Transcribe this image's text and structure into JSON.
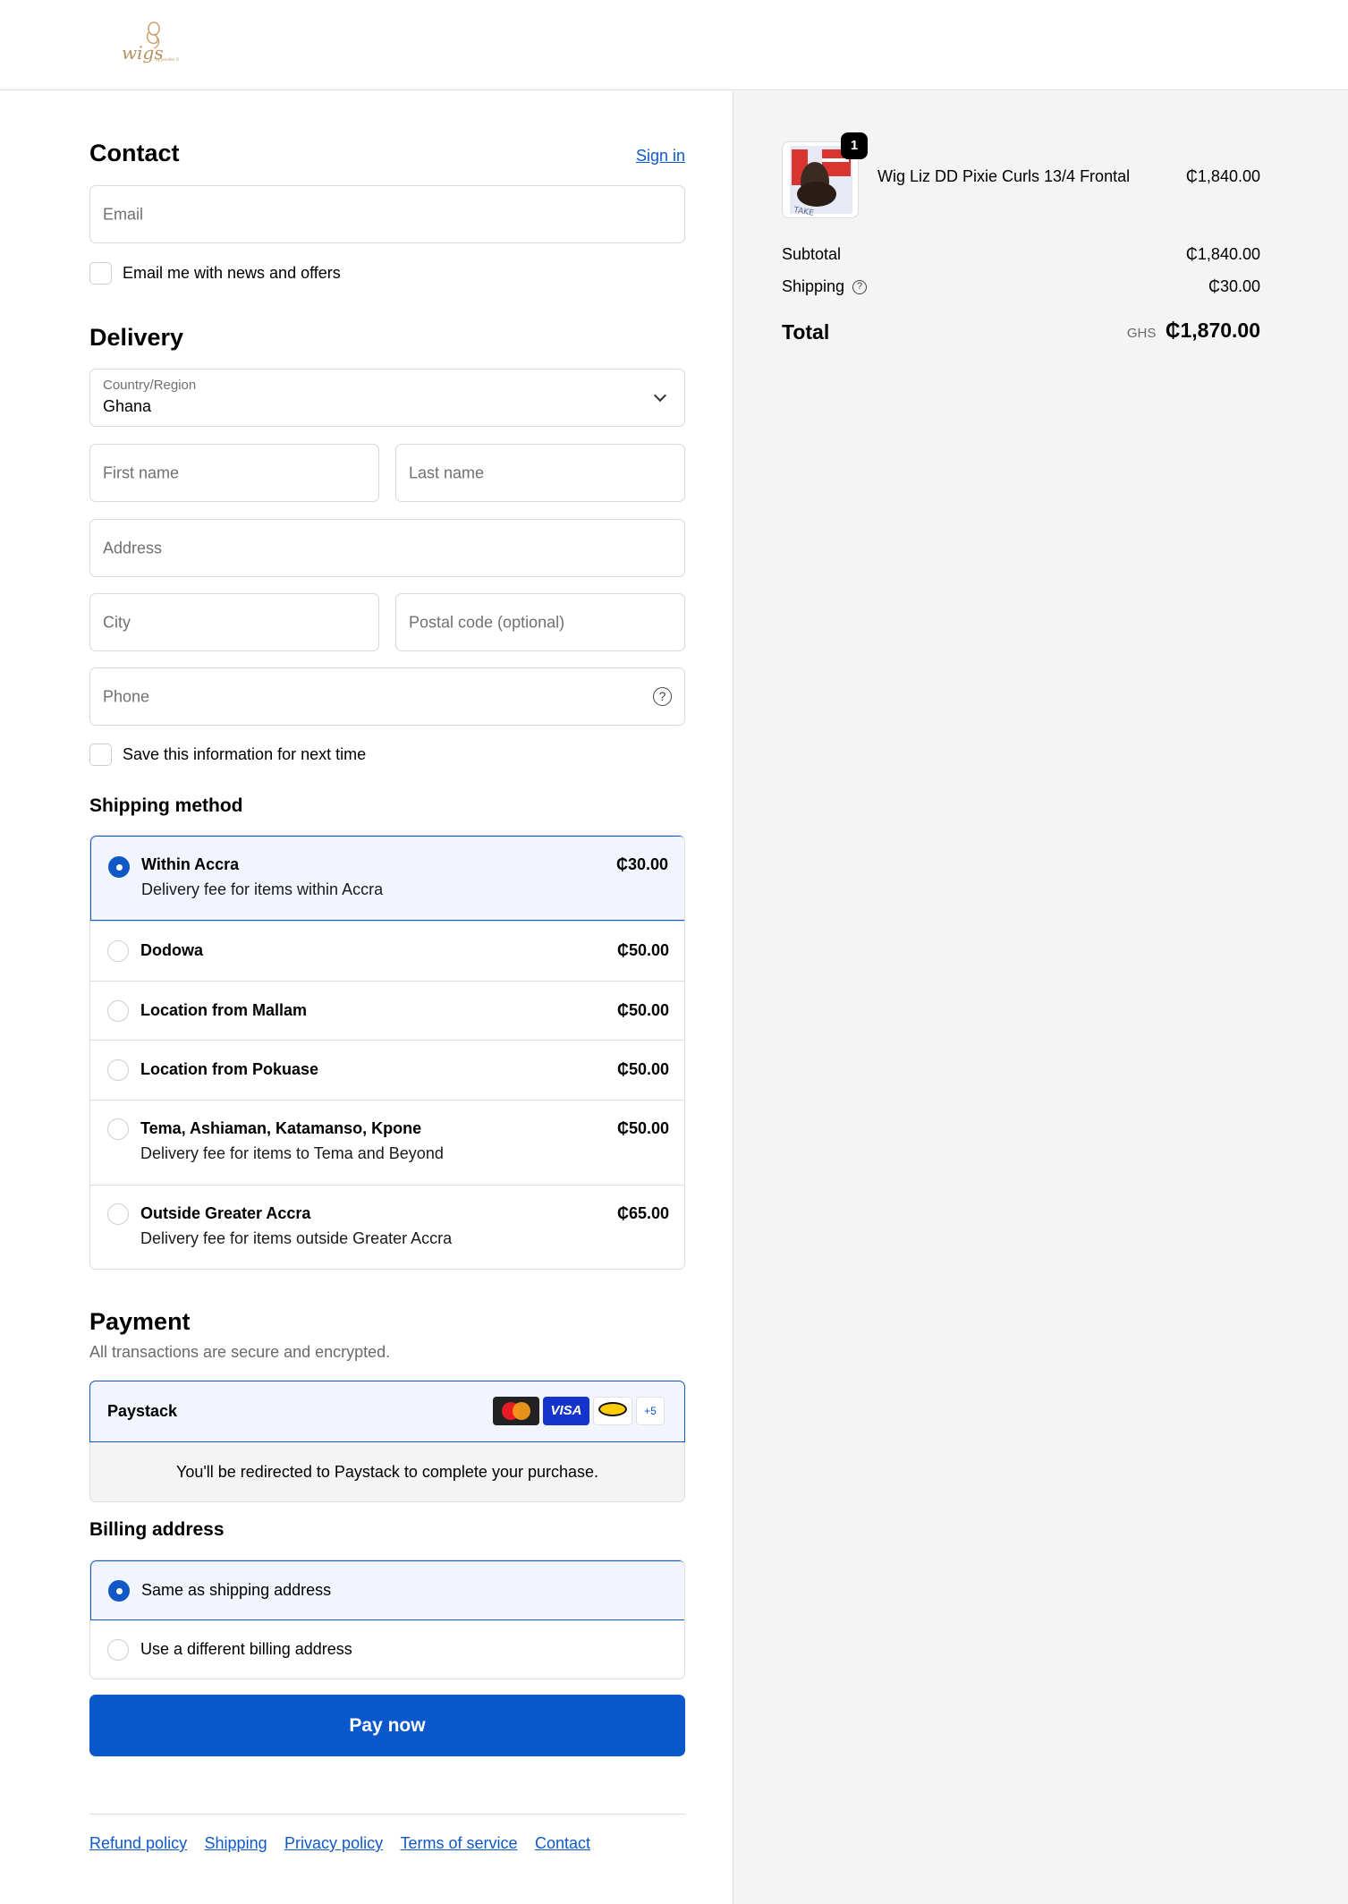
{
  "header": {
    "logo_text": "wigs"
  },
  "contact": {
    "title": "Contact",
    "sign_in": "Sign in",
    "email_placeholder": "Email",
    "news_label": "Email me with news and offers"
  },
  "delivery": {
    "title": "Delivery",
    "country_label": "Country/Region",
    "country_value": "Ghana",
    "first_name_placeholder": "First name",
    "last_name_placeholder": "Last name",
    "address_placeholder": "Address",
    "city_placeholder": "City",
    "postal_placeholder": "Postal code (optional)",
    "phone_placeholder": "Phone",
    "save_label": "Save this information for next time"
  },
  "shipping_method": {
    "title": "Shipping method",
    "options": [
      {
        "name": "Within Accra",
        "desc": "Delivery fee for items within Accra",
        "price": "₵30.00",
        "selected": true
      },
      {
        "name": "Dodowa",
        "desc": "",
        "price": "₵50.00",
        "selected": false
      },
      {
        "name": "Location from Mallam",
        "desc": "",
        "price": "₵50.00",
        "selected": false
      },
      {
        "name": "Location from Pokuase",
        "desc": "",
        "price": "₵50.00",
        "selected": false
      },
      {
        "name": "Tema, Ashiaman, Katamanso, Kpone",
        "desc": "Delivery fee for items to Tema and Beyond",
        "price": "₵50.00",
        "selected": false
      },
      {
        "name": "Outside Greater Accra",
        "desc": "Delivery fee for items outside Greater Accra",
        "price": "₵65.00",
        "selected": false
      }
    ]
  },
  "payment": {
    "title": "Payment",
    "subtitle": "All transactions are secure and encrypted.",
    "provider": "Paystack",
    "cards": {
      "visa": "VISA",
      "more": "+5"
    },
    "redirect_note": "You'll be redirected to Paystack to complete your purchase."
  },
  "billing": {
    "title": "Billing address",
    "same": "Same as shipping address",
    "different": "Use a different billing address"
  },
  "pay_button": "Pay now",
  "footer": {
    "links": [
      "Refund policy",
      "Shipping",
      "Privacy policy",
      "Terms of service",
      "Contact"
    ]
  },
  "summary": {
    "item_name": "Wig Liz DD Pixie Curls 13/4 Frontal",
    "item_price": "₵1,840.00",
    "item_qty": "1",
    "subtotal_label": "Subtotal",
    "subtotal_value": "₵1,840.00",
    "shipping_label": "Shipping",
    "shipping_value": "₵30.00",
    "total_label": "Total",
    "currency": "GHS",
    "total_value": "₵1,870.00"
  },
  "colors": {
    "accent": "#1058c7",
    "pay_button": "#0b58cc",
    "summary_bg": "#f4f4f4",
    "selected_bg": "#f2f5fd"
  }
}
